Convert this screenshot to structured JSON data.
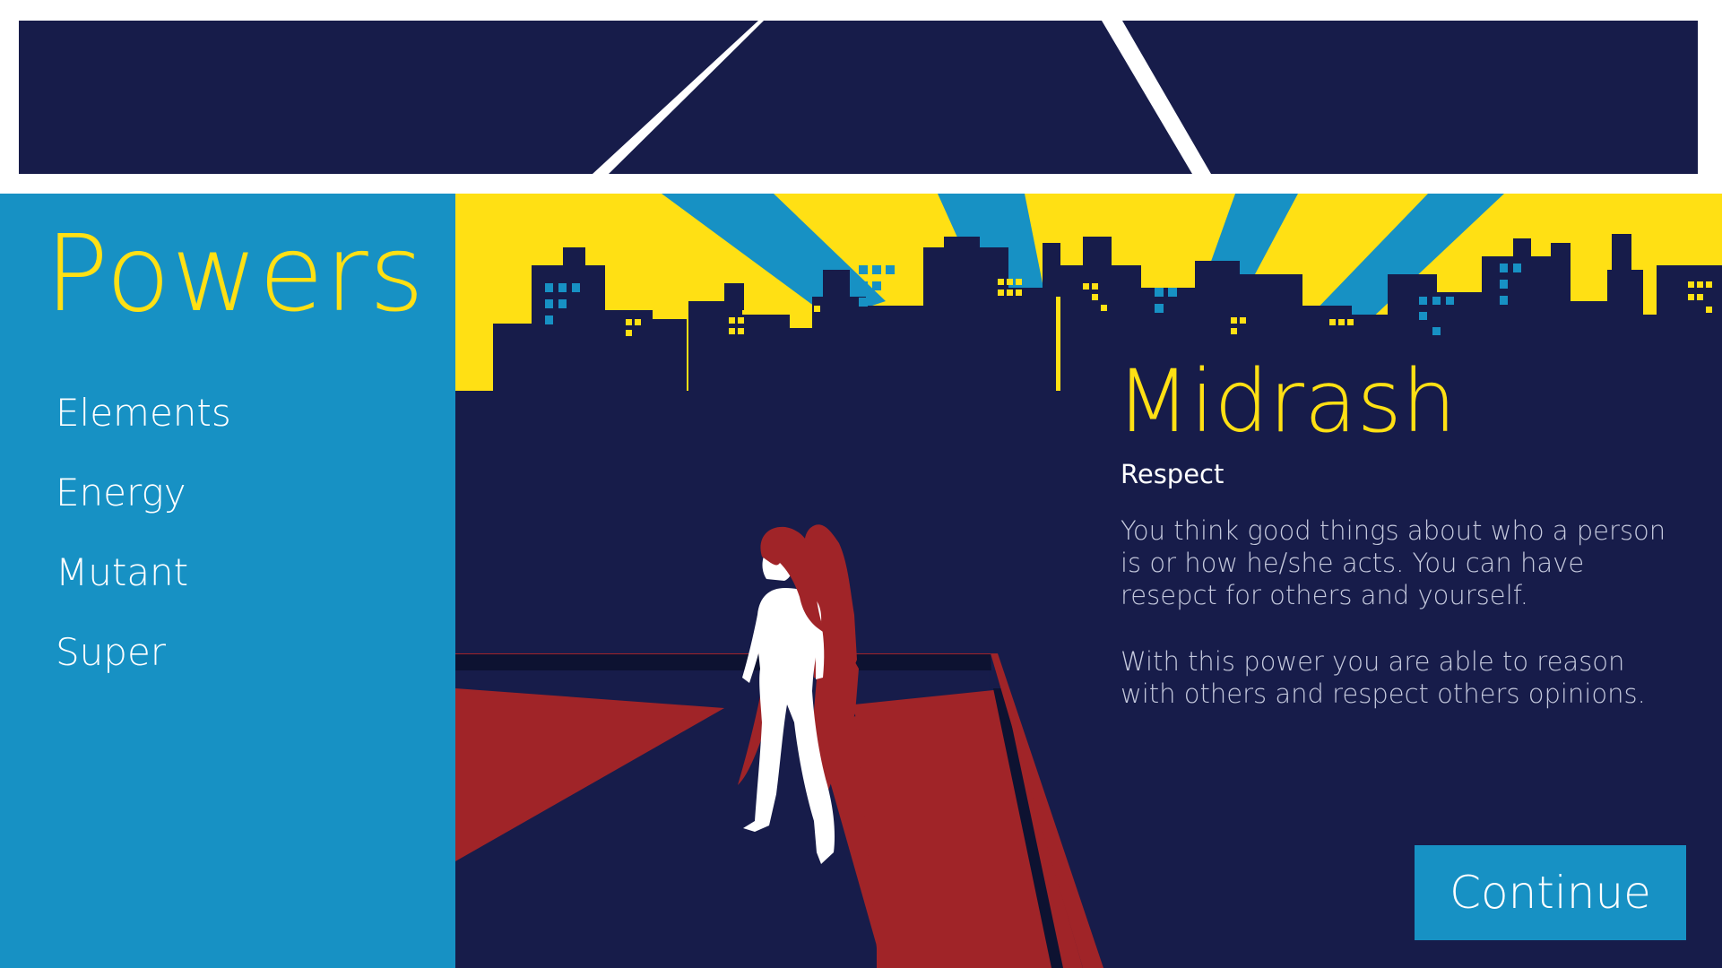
{
  "sidebar": {
    "title": "Powers",
    "items": [
      {
        "label": "Elements"
      },
      {
        "label": "Energy"
      },
      {
        "label": "Mutant"
      },
      {
        "label": "Super"
      }
    ]
  },
  "detail": {
    "hero_name": "Midrash",
    "power_name": "Respect",
    "description_1": "You think good things about who a person is or how he/she acts. You can have resepct for others and yourself.",
    "description_2": "With this power you are able to reason with others and respect others opinions."
  },
  "actions": {
    "continue_label": "Continue"
  },
  "colors": {
    "navy": "#171c4a",
    "sky_blue": "#1791c4",
    "yellow": "#ffe014",
    "red": "#a02428",
    "white": "#ffffff"
  },
  "icons": {
    "hero": "superhero-silhouette",
    "skyline": "city-skyline",
    "rooftop": "rooftop"
  }
}
